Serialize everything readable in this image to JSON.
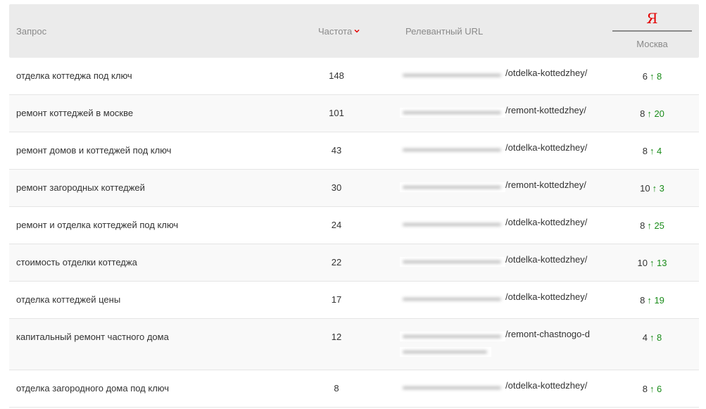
{
  "header": {
    "query_label": "Запрос",
    "frequency_label": "Частота",
    "url_label": "Релевантный URL",
    "search_engine_logo": "Я",
    "region_label": "Москва",
    "colors": {
      "brand_red": "#e30000",
      "up_green": "#1a8c1a"
    }
  },
  "rows": [
    {
      "query": "отделка коттеджа под ключ",
      "frequency": "148",
      "url_path": "/otdelka-kottedzhey/",
      "position": "6",
      "change": "↑ 8"
    },
    {
      "query": "ремонт коттеджей в москве",
      "frequency": "101",
      "url_path": "/remont-kottedzhey/",
      "position": "8",
      "change": "↑ 20"
    },
    {
      "query": "ремонт домов и коттеджей под ключ",
      "frequency": "43",
      "url_path": "/otdelka-kottedzhey/",
      "position": "8",
      "change": "↑ 4"
    },
    {
      "query": "ремонт загородных коттеджей",
      "frequency": "30",
      "url_path": "/remont-kottedzhey/",
      "position": "10",
      "change": "↑ 3"
    },
    {
      "query": "ремонт и отделка коттеджей под ключ",
      "frequency": "24",
      "url_path": "/otdelka-kottedzhey/",
      "position": "8",
      "change": "↑ 25"
    },
    {
      "query": "стоимость отделки коттеджа",
      "frequency": "22",
      "url_path": "/otdelka-kottedzhey/",
      "position": "10",
      "change": "↑ 13"
    },
    {
      "query": "отделка коттеджей цены",
      "frequency": "17",
      "url_path": "/otdelka-kottedzhey/",
      "position": "8",
      "change": "↑ 19"
    },
    {
      "query": "капитальный ремонт частного дома",
      "frequency": "12",
      "url_path": "/remont-chastnogo-d",
      "position": "4",
      "change": "↑ 8"
    },
    {
      "query": "отделка загородного дома под ключ",
      "frequency": "8",
      "url_path": "/otdelka-kottedzhey/",
      "position": "8",
      "change": "↑ 6"
    }
  ]
}
